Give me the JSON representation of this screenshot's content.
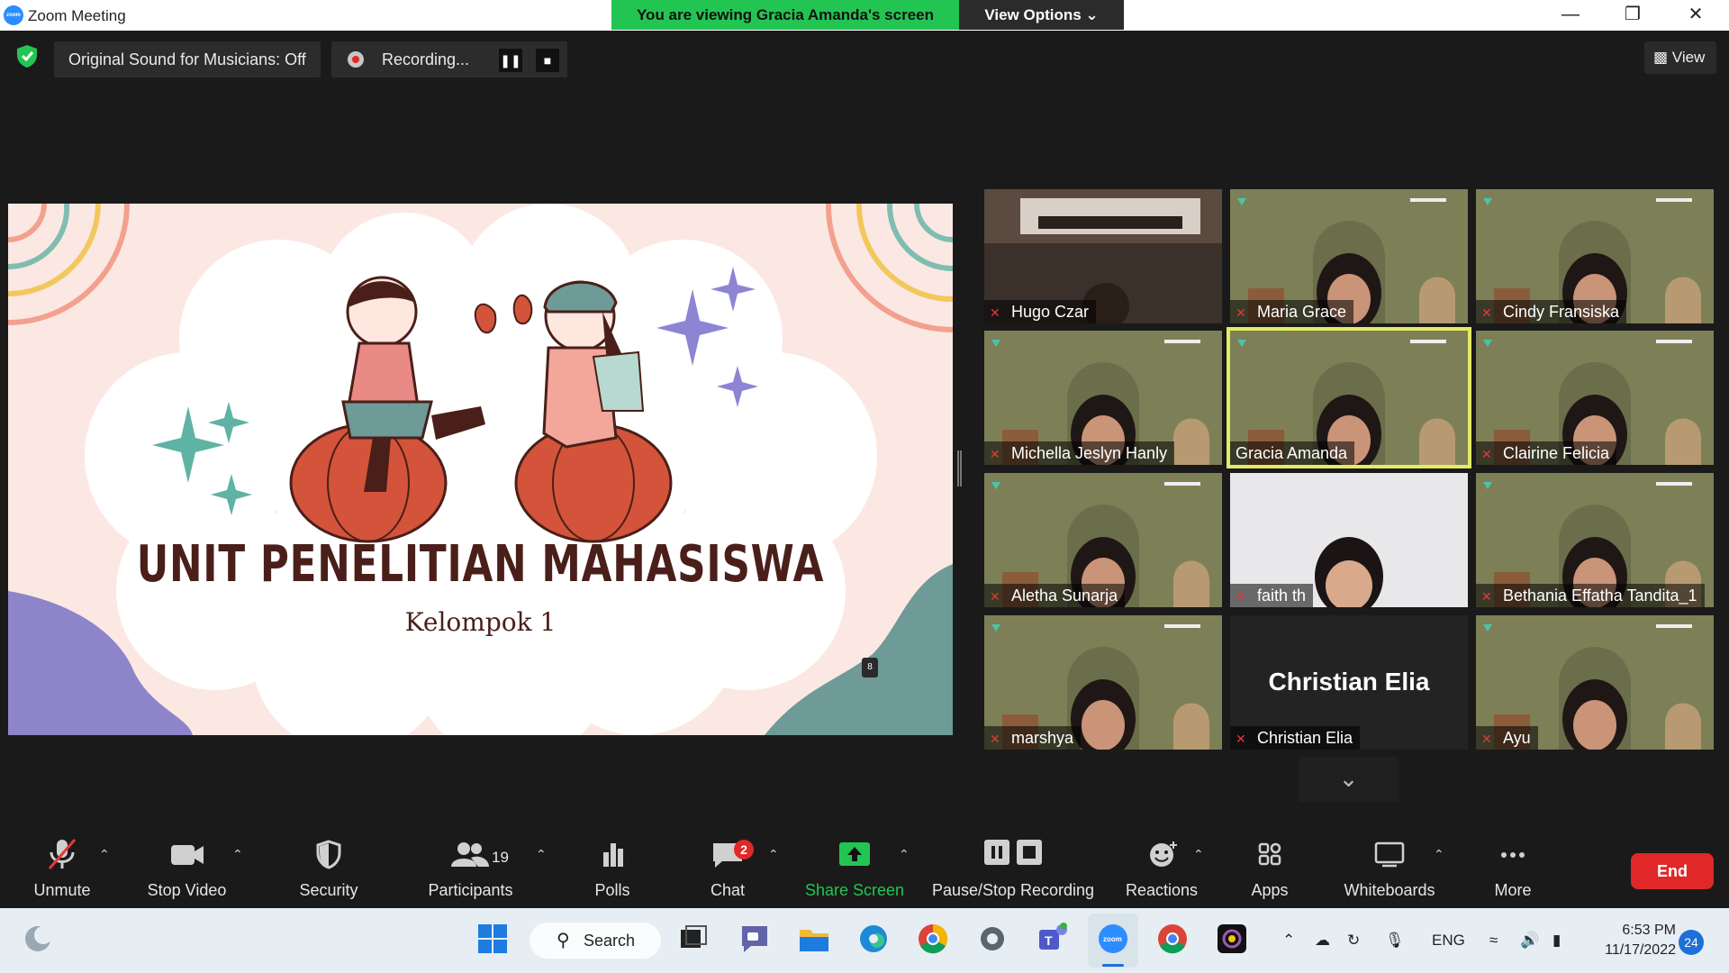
{
  "window": {
    "title": "Zoom Meeting"
  },
  "banner": {
    "viewing": "You are viewing Gracia Amanda's screen",
    "view_options": "View Options ⌄"
  },
  "top_bar": {
    "original_sound": "Original Sound for Musicians: Off",
    "recording": "Recording...",
    "view_label": "View"
  },
  "shared_slide": {
    "title": "UNIT PENELITIAN MAHASISWA",
    "subtitle": "Kelompok 1",
    "page_badge": "8",
    "colors": {
      "background": "#fbe8e3",
      "cloud": "#ffffff",
      "title": "#4a1f1a",
      "sparkle_purple": "#8d84d4",
      "sparkle_teal": "#5fb3a4",
      "blob_purple": "#8d84c9",
      "blob_teal": "#6e9a97"
    }
  },
  "participants": [
    {
      "name": "Hugo Czar",
      "muted": true,
      "active": false,
      "style": "room"
    },
    {
      "name": "Maria Grace",
      "muted": true,
      "active": false,
      "style": "virtual"
    },
    {
      "name": "Cindy Fransiska",
      "muted": true,
      "active": false,
      "style": "virtual"
    },
    {
      "name": "Michella Jeslyn Hanly",
      "muted": true,
      "active": false,
      "style": "virtual"
    },
    {
      "name": "Gracia Amanda",
      "muted": false,
      "active": true,
      "style": "virtual"
    },
    {
      "name": "Clairine Felicia",
      "muted": true,
      "active": false,
      "style": "virtual"
    },
    {
      "name": "Aletha Sunarja",
      "muted": true,
      "active": false,
      "style": "virtual"
    },
    {
      "name": "faith th",
      "muted": true,
      "active": false,
      "style": "wall"
    },
    {
      "name": "Bethania Effatha Tandita_1",
      "muted": true,
      "active": false,
      "style": "virtual"
    },
    {
      "name": "marshya",
      "muted": true,
      "active": false,
      "style": "virtual"
    },
    {
      "name": "Christian Elia",
      "muted": true,
      "active": false,
      "style": "no-video",
      "big_name": "Christian Elia"
    },
    {
      "name": "Ayu",
      "muted": true,
      "active": false,
      "style": "virtual"
    }
  ],
  "toolbar": {
    "unmute": "Unmute",
    "stop_video": "Stop Video",
    "security": "Security",
    "participants": "Participants",
    "participants_count": "19",
    "polls": "Polls",
    "chat": "Chat",
    "chat_badge": "2",
    "share_screen": "Share Screen",
    "pause_stop_recording": "Pause/Stop Recording",
    "reactions": "Reactions",
    "apps": "Apps",
    "whiteboards": "Whiteboards",
    "more": "More",
    "end": "End"
  },
  "taskbar": {
    "search": "Search",
    "language": "ENG",
    "time": "6:53 PM",
    "date": "11/17/2022",
    "notifications": "24"
  }
}
